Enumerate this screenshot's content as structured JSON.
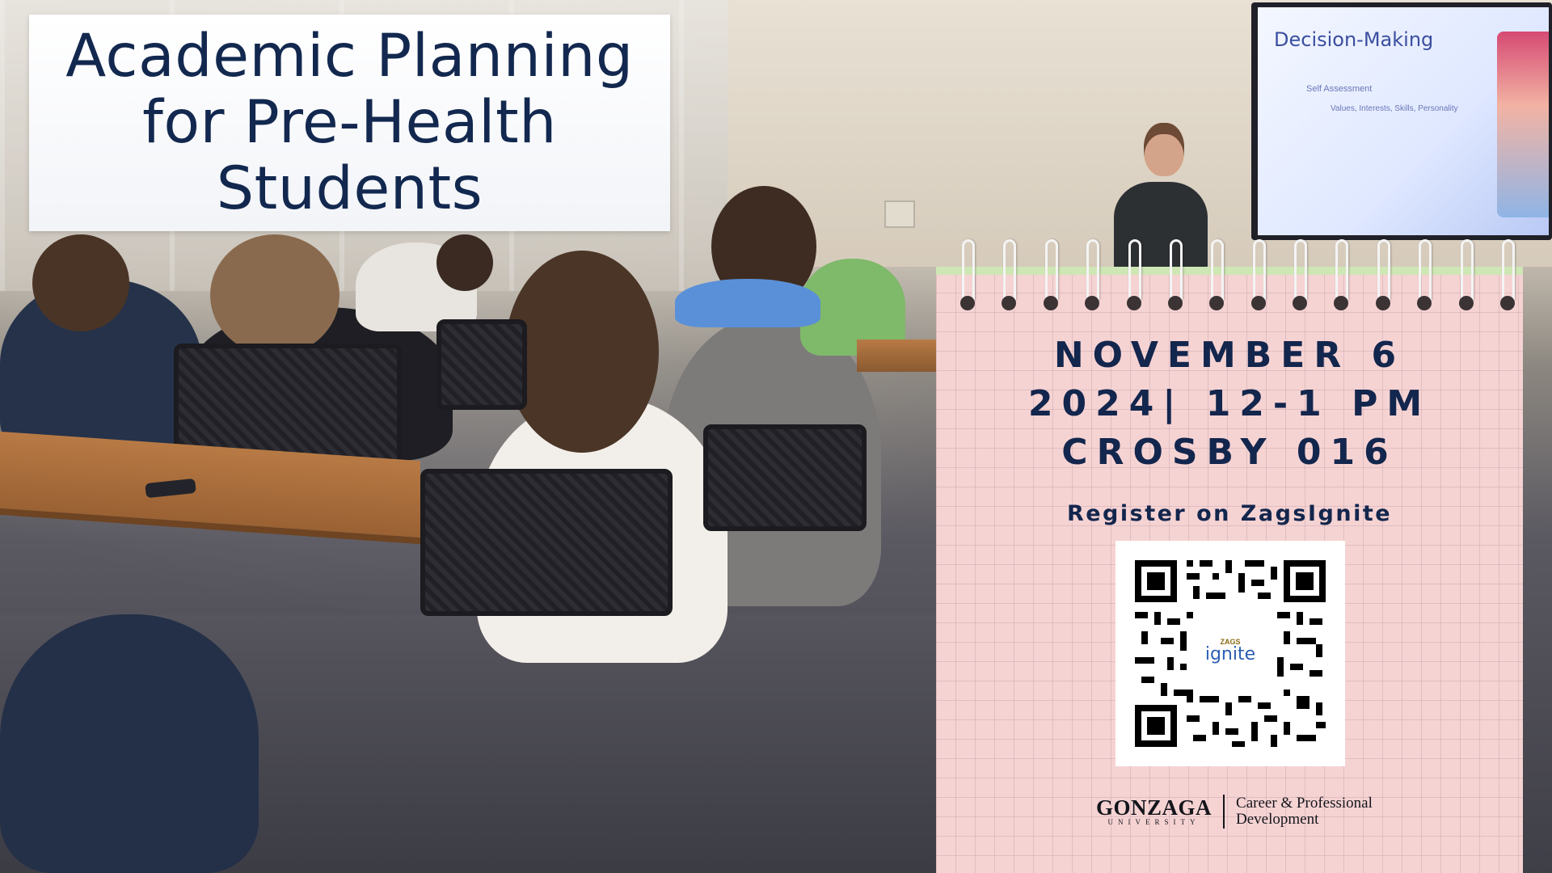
{
  "title": {
    "line1": "Academic Planning",
    "line2": "for Pre-Health",
    "line3": "Students"
  },
  "event": {
    "date_line": "NOVEMBER 6",
    "time_line": "2024| 12-1 PM",
    "location_line": "CROSBY 016"
  },
  "registration": {
    "text": "Register on ZagsIgnite",
    "qr_logo_small": "ZAGS",
    "qr_logo_main": "ignite"
  },
  "presentation_screen": {
    "title": "Decision-Making",
    "bullet1": "Self Assessment",
    "bullet2": "Values, Interests, Skills, Personality"
  },
  "footer": {
    "university_name": "GONZAGA",
    "university_sub": "UNIVERSITY",
    "department_line1": "Career & Professional",
    "department_line2": "Development"
  },
  "colors": {
    "title_navy": "#12284f",
    "notepad_pink": "#f6d3d3",
    "detail_navy": "#13264d"
  }
}
